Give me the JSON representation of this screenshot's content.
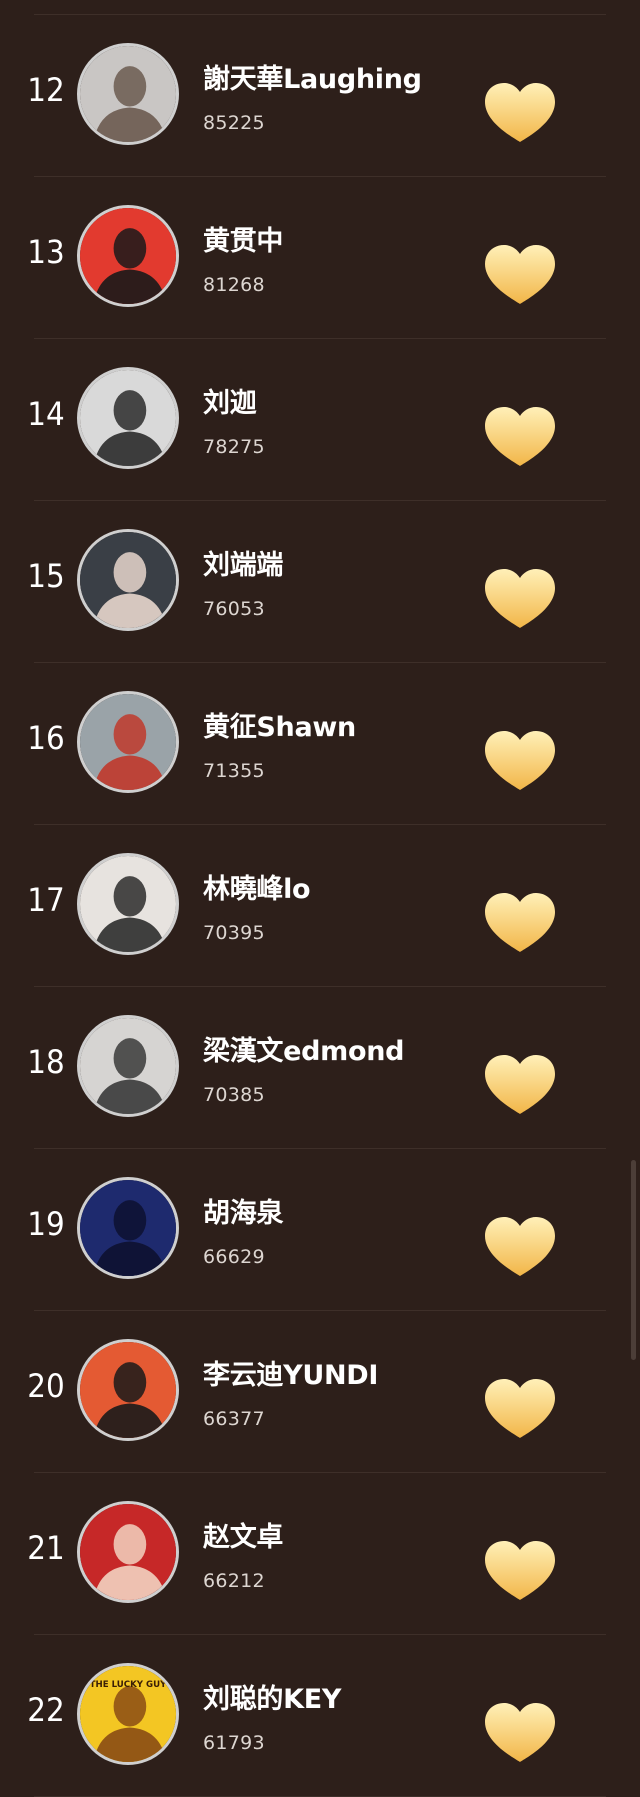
{
  "rankings": [
    {
      "rank": "12",
      "name": "謝天華Laughing",
      "votes": "85225",
      "avatar_icon": "avatar-shirtless-man-icon",
      "avatar_colors": [
        "#c9c6c4",
        "#6b5a50"
      ]
    },
    {
      "rank": "13",
      "name": "黄贯中",
      "votes": "81268",
      "avatar_icon": "avatar-abs-icon",
      "avatar_colors": [
        "#e23a2f",
        "#1a1a1a"
      ]
    },
    {
      "rank": "14",
      "name": "刘迦",
      "votes": "78275",
      "avatar_icon": "avatar-profile-icon",
      "avatar_colors": [
        "#d9d9d9",
        "#2a2a2a"
      ]
    },
    {
      "rank": "15",
      "name": "刘端端",
      "votes": "76053",
      "avatar_icon": "avatar-portrait-icon",
      "avatar_colors": [
        "#3a3f46",
        "#e8d6cc"
      ]
    },
    {
      "rank": "16",
      "name": "黄征Shawn",
      "votes": "71355",
      "avatar_icon": "avatar-boxer-icon",
      "avatar_colors": [
        "#9aa3a8",
        "#c0392b"
      ]
    },
    {
      "rank": "17",
      "name": "林曉峰lo",
      "votes": "70395",
      "avatar_icon": "avatar-glasses-icon",
      "avatar_colors": [
        "#e7e3df",
        "#2c2c2c"
      ]
    },
    {
      "rank": "18",
      "name": "梁漢文edmond",
      "votes": "70385",
      "avatar_icon": "avatar-bw-portrait-icon",
      "avatar_colors": [
        "#d6d4d2",
        "#3a3a3a"
      ]
    },
    {
      "rank": "19",
      "name": "胡海泉",
      "votes": "66629",
      "avatar_icon": "avatar-stage-icon",
      "avatar_colors": [
        "#1e2a6e",
        "#0d1130"
      ]
    },
    {
      "rank": "20",
      "name": "李云迪YUNDI",
      "votes": "66377",
      "avatar_icon": "avatar-tuxedo-icon",
      "avatar_colors": [
        "#e45a33",
        "#1a1a1a"
      ]
    },
    {
      "rank": "21",
      "name": "赵文卓",
      "votes": "66212",
      "avatar_icon": "avatar-suit-icon",
      "avatar_colors": [
        "#c62828",
        "#f2d2c0"
      ]
    },
    {
      "rank": "22",
      "name": "刘聪的KEY",
      "votes": "61793",
      "avatar_icon": "avatar-lucky-guy-icon",
      "avatar_colors": [
        "#f3c623",
        "#8a4b14"
      ]
    }
  ],
  "avatar_22_badge_text": "THE LUCKY GUY",
  "heart_icon": "heart-icon",
  "colors": {
    "background": "#2d1f1a",
    "divider": "#3e2f29",
    "heart_top": "#fff0b8",
    "heart_bottom": "#f2b648",
    "text": "#ffffff",
    "votes_text": "#ddd6d1"
  }
}
